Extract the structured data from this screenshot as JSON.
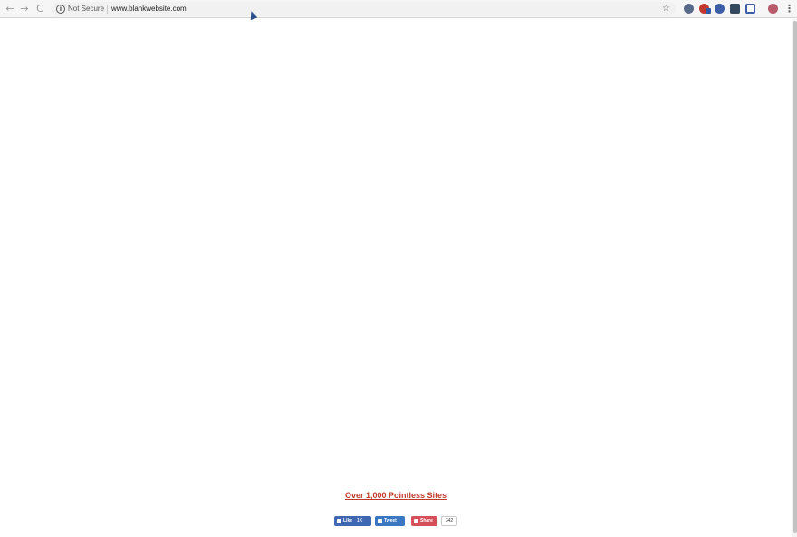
{
  "browser": {
    "nav": {
      "back": "←",
      "forward": "→",
      "reload": "C"
    },
    "security_label": "Not Secure",
    "url": "www.blankwebsite.com",
    "info_glyph": "i",
    "star_glyph": "☆",
    "menu_glyph": "⋮"
  },
  "page": {
    "link_text": "Over 1,000 Pointless Sites",
    "link_color": "#c0392b"
  },
  "share": {
    "like_label": "Like",
    "like_count": "1K",
    "tweet_label": "Tweet",
    "share_label": "Share",
    "share_count": "342"
  }
}
